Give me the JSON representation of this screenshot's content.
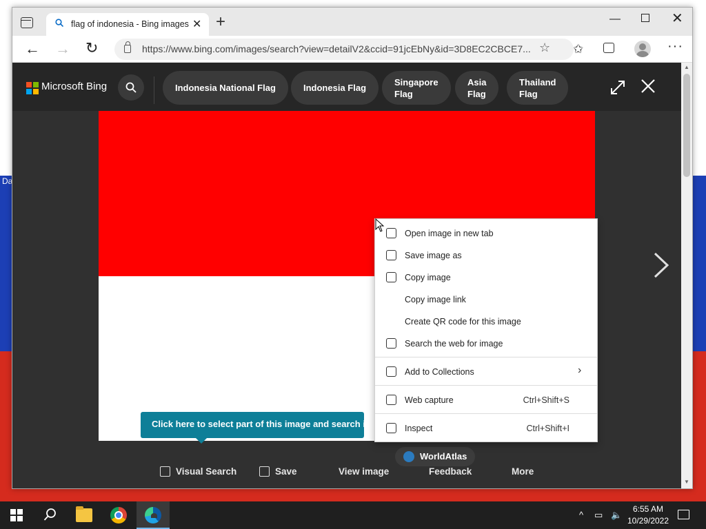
{
  "desktop": {
    "peek_text": "Da"
  },
  "browser": {
    "tab": {
      "title": "flag of indonesia - Bing images",
      "close": "✕"
    },
    "new_tab": "+",
    "window": {
      "minimize": "—",
      "close": "✕"
    },
    "address": {
      "url": "https://www.bing.com/images/search?view=detailV2&ccid=91jcEbNy&id=3D8EC2CBCE7..."
    },
    "nav": {
      "back": "←",
      "forward": "→",
      "refresh": "↻"
    },
    "more": "···"
  },
  "bing": {
    "brand": "Microsoft Bing",
    "logo_colors": [
      "#f25022",
      "#7fba00",
      "#00a4ef",
      "#ffb900"
    ],
    "related_chips": [
      {
        "line1": "Indonesia National Flag",
        "line2": ""
      },
      {
        "line1": "Indonesia Flag",
        "line2": ""
      },
      {
        "line1": "Singapore",
        "line2": "Flag"
      },
      {
        "line1": "Asia",
        "line2": "Flag"
      },
      {
        "line1": "Thailand",
        "line2": "Flag"
      }
    ],
    "image": {
      "top_color": "#ff0000",
      "bottom_color": "#ffffff",
      "source": "WorldAtlas"
    },
    "tooltip": "Click here to select part of this image and search it",
    "bottom_actions": {
      "visual_search": "Visual Search",
      "save": "Save",
      "view_image": "View image",
      "feedback": "Feedback",
      "more": "More"
    }
  },
  "context_menu": {
    "items": [
      {
        "label": "Open image in new tab",
        "shortcut": "",
        "icon": "open-new-tab-icon"
      },
      {
        "label": "Save image as",
        "shortcut": "",
        "icon": "save-image-icon"
      },
      {
        "label": "Copy image",
        "shortcut": "",
        "icon": "copy-image-icon"
      },
      {
        "label": "Copy image link",
        "shortcut": "",
        "icon": ""
      },
      {
        "label": "Create QR code for this image",
        "shortcut": "",
        "icon": ""
      },
      {
        "label": "Search the web for image",
        "shortcut": "",
        "icon": "visual-search-icon"
      },
      {
        "label": "Add to Collections",
        "shortcut": "",
        "icon": "add-collection-icon"
      },
      {
        "label": "Web capture",
        "shortcut": "Ctrl+Shift+S",
        "icon": "web-capture-icon"
      },
      {
        "label": "Inspect",
        "shortcut": "Ctrl+Shift+I",
        "icon": "inspect-icon"
      }
    ],
    "submenu_chevron": "›"
  },
  "taskbar": {
    "tray_chevron": "^",
    "time": "6:55 AM",
    "date": "10/29/2022"
  }
}
